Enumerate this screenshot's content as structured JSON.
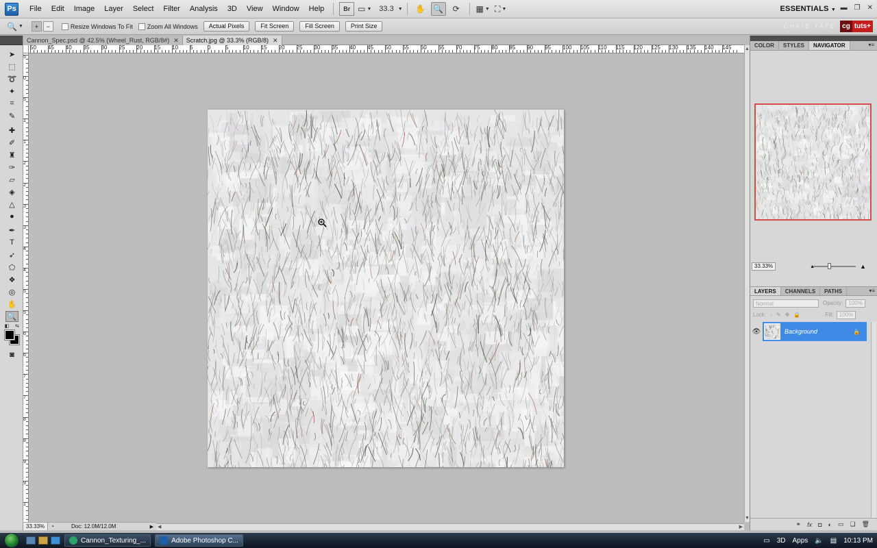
{
  "app": {
    "logo": "Ps",
    "title": "Adobe Photoshop CS4"
  },
  "menubar": {
    "items": [
      "File",
      "Edit",
      "Image",
      "Layer",
      "Select",
      "Filter",
      "Analysis",
      "3D",
      "View",
      "Window",
      "Help"
    ],
    "bridge_label": "Br",
    "zoom_value": "33.3",
    "workspace": "ESSENTIALS"
  },
  "options_bar": {
    "resize_windows_label": "Resize Windows To Fit",
    "zoom_all_label": "Zoom All Windows",
    "buttons": [
      "Actual Pixels",
      "Fit Screen",
      "Fill Screen",
      "Print Size"
    ],
    "watermark": "CHRIS TATE",
    "brand_cg": "cg",
    "brand_tuts": "tuts+"
  },
  "document_tabs": [
    {
      "label": "Cannon_Spec.psd @ 42.5% (Wheel_Rust, RGB/8#)",
      "active": false
    },
    {
      "label": "Scratch.jpg @ 33.3% (RGB/8)",
      "active": true
    }
  ],
  "ruler": {
    "h_labels": [
      "50",
      "45",
      "40",
      "35",
      "30",
      "25",
      "20",
      "15",
      "10",
      "5",
      "0",
      "5",
      "10",
      "15",
      "20",
      "25",
      "30",
      "35",
      "40",
      "45",
      "50",
      "55",
      "60",
      "65",
      "70",
      "75",
      "80",
      "85",
      "90",
      "95",
      "100",
      "105",
      "110",
      "115",
      "120",
      "125",
      "130",
      "135",
      "140",
      "145"
    ],
    "v_labels": [
      "5",
      "0",
      "5",
      "1",
      "1",
      "2",
      "2",
      "3",
      "3",
      "4",
      "4",
      "5",
      "5",
      "6",
      "6",
      "7",
      "7",
      "8",
      "8",
      "9",
      "9",
      "1"
    ]
  },
  "status": {
    "zoom": "33.33%",
    "doc": "Doc: 12.0M/12.0M"
  },
  "panels": {
    "top_tabs": [
      "COLOR",
      "STYLES",
      "NAVIGATOR"
    ],
    "top_active": "NAVIGATOR",
    "navigator_zoom": "33.33%",
    "layer_tabs": [
      "LAYERS",
      "CHANNELS",
      "PATHS"
    ],
    "layer_active": "LAYERS",
    "blend_mode": "Normal",
    "opacity_label": "Opacity:",
    "opacity_value": "100%",
    "lock_label": "Lock:",
    "fill_label": "Fill:",
    "fill_value": "100%",
    "layer_name": "Background"
  },
  "taskbar": {
    "tasks": [
      {
        "label": "Cannon_Texturing_...",
        "active": false
      },
      {
        "label": "Adobe Photoshop C...",
        "active": true
      }
    ],
    "tray_3d": "3D",
    "tray_apps": "Apps",
    "clock": "10:13 PM"
  },
  "colors": {
    "accent": "#3f8ae5",
    "nav_frame": "#d64b4b",
    "foreground": "#000000",
    "background": "#000000"
  }
}
